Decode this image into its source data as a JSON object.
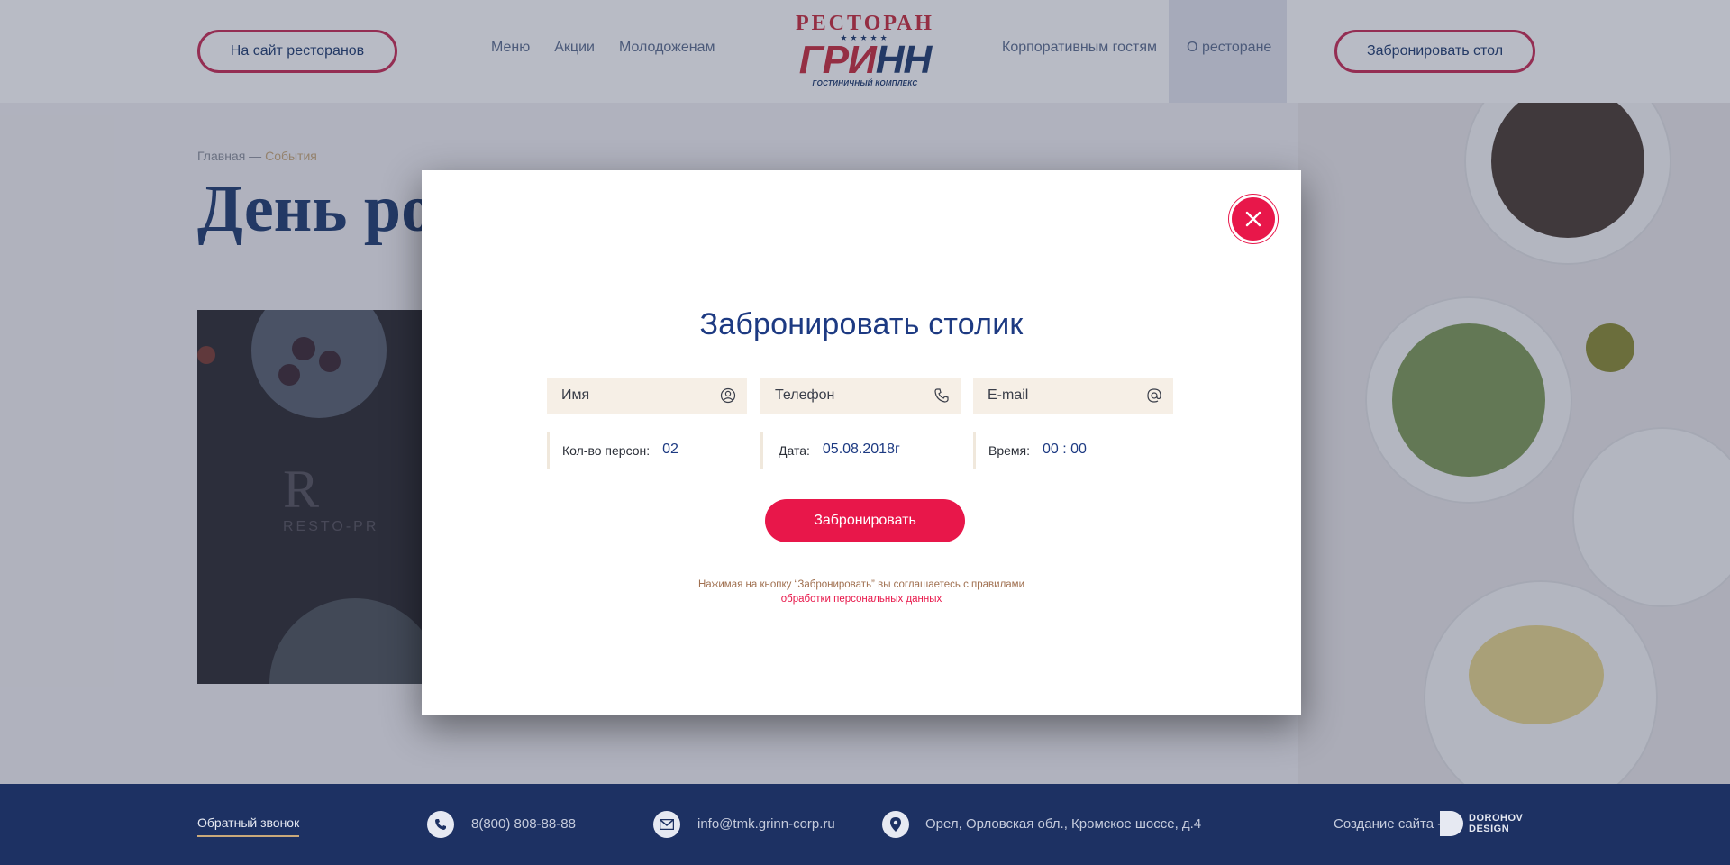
{
  "header": {
    "left_button": "На сайт ресторанов",
    "nav_left": [
      "Меню",
      "Акции",
      "Молодоженам"
    ],
    "nav_right": [
      "Корпоративным гостям",
      "О ресторане"
    ],
    "right_button": "Забронировать стол",
    "logo": {
      "top": "РЕСТОРАН",
      "main_red": "ГРИ",
      "main_blue": "НН",
      "sub": "ГОСТИНИЧНЫЙ КОМПЛЕКС",
      "stars": "★★★★★"
    }
  },
  "page": {
    "breadcrumb_home": "Главная",
    "breadcrumb_sep": " — ",
    "breadcrumb_current": "События",
    "title": "День ро",
    "photo_logo": "R",
    "photo_logo_sub": "RESTO-PR"
  },
  "modal": {
    "title": "Забронировать столик",
    "name_placeholder": "Имя",
    "phone_placeholder": "Телефон",
    "email_placeholder": "E-mail",
    "persons_label": "Кол-во персон:",
    "persons_value": "02",
    "date_label": "Дата:",
    "date_value": "05.08.2018г",
    "time_label": "Время:",
    "time_value": "00 : 00",
    "submit_label": "Забронировать",
    "agree_text": "Нажимая на кнопку “Забронировать” вы соглашаетесь с правилами",
    "agree_link": "обработки персональных данных"
  },
  "footer": {
    "callback": "Обратный звонок",
    "phone": "8(800) 808-88-88",
    "email": "info@tmk.grinn-corp.ru",
    "address": "Орел, Орловская обл., Кромское шоссе, д.4",
    "creator_label": "Создание сайта -",
    "creator_brand_1": "DOROHOV",
    "creator_brand_2": "DESIGN"
  },
  "colors": {
    "accent_red": "#e8174a",
    "brand_blue": "#1d3a82",
    "footer_bg": "#1d3163",
    "field_bg": "#f6efe6"
  }
}
